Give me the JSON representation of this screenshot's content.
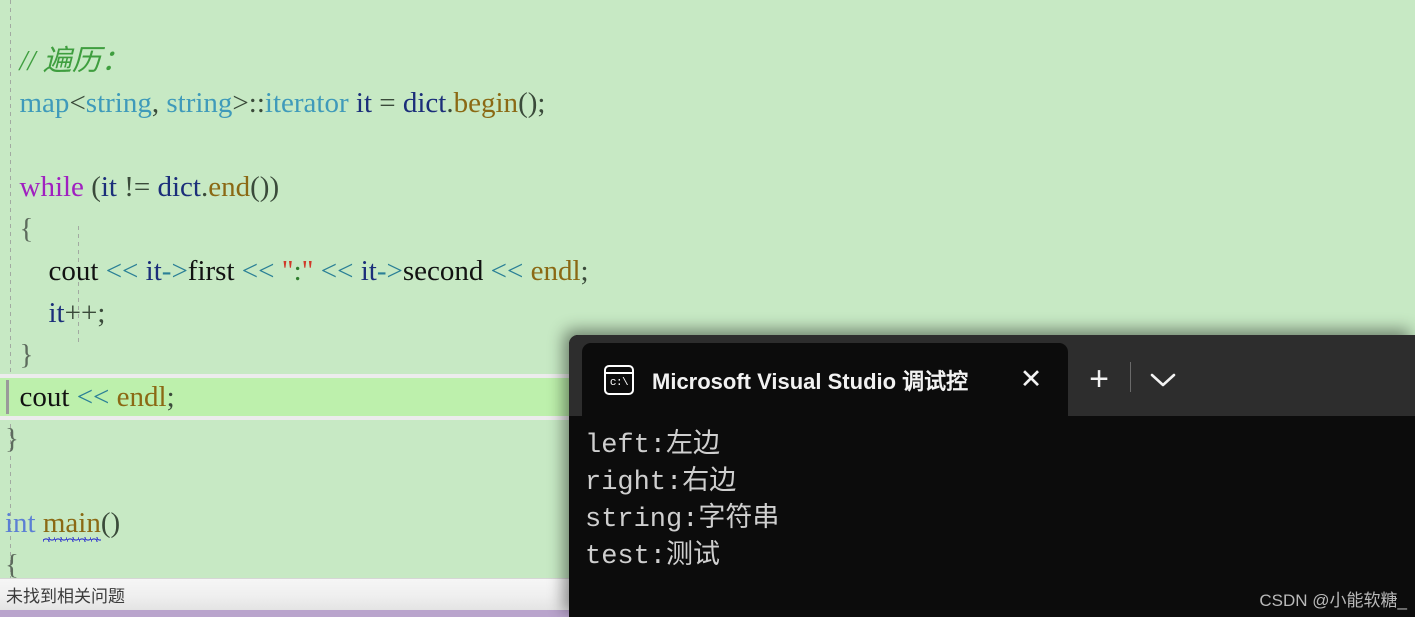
{
  "editor": {
    "background_color": "#c7e9c4",
    "current_line_color": "#bdf0ac",
    "lines": [
      {
        "indent": "  ",
        "tokens": [
          {
            "cls": "t-cmt",
            "text": "// 遍历："
          }
        ]
      },
      {
        "indent": "  ",
        "tokens": [
          {
            "cls": "t-type",
            "text": "map"
          },
          {
            "cls": "t-punct",
            "text": "<"
          },
          {
            "cls": "t-type",
            "text": "string"
          },
          {
            "cls": "t-punct",
            "text": ", "
          },
          {
            "cls": "t-type",
            "text": "string"
          },
          {
            "cls": "t-punct",
            "text": ">::"
          },
          {
            "cls": "t-type",
            "text": "iterator"
          },
          {
            "cls": "t-plain",
            "text": " "
          },
          {
            "cls": "t-var",
            "text": "it"
          },
          {
            "cls": "t-plain",
            "text": " "
          },
          {
            "cls": "t-punct",
            "text": "="
          },
          {
            "cls": "t-plain",
            "text": " "
          },
          {
            "cls": "t-var",
            "text": "dict"
          },
          {
            "cls": "t-punct",
            "text": "."
          },
          {
            "cls": "t-fn",
            "text": "begin"
          },
          {
            "cls": "t-punct",
            "text": "();"
          }
        ]
      },
      {
        "indent": "",
        "tokens": []
      },
      {
        "indent": "  ",
        "tokens": [
          {
            "cls": "t-kw",
            "text": "while"
          },
          {
            "cls": "t-plain",
            "text": " "
          },
          {
            "cls": "t-punct",
            "text": "("
          },
          {
            "cls": "t-var",
            "text": "it"
          },
          {
            "cls": "t-plain",
            "text": " "
          },
          {
            "cls": "t-punct",
            "text": "!="
          },
          {
            "cls": "t-plain",
            "text": " "
          },
          {
            "cls": "t-var",
            "text": "dict"
          },
          {
            "cls": "t-punct",
            "text": "."
          },
          {
            "cls": "t-fn",
            "text": "end"
          },
          {
            "cls": "t-punct",
            "text": "())"
          }
        ]
      },
      {
        "indent": "  ",
        "tokens": [
          {
            "cls": "t-brace",
            "text": "{"
          }
        ]
      },
      {
        "indent": "      ",
        "tokens": [
          {
            "cls": "t-plain",
            "text": "cout"
          },
          {
            "cls": "t-plain",
            "text": " "
          },
          {
            "cls": "t-op",
            "text": "<<"
          },
          {
            "cls": "t-plain",
            "text": " "
          },
          {
            "cls": "t-var",
            "text": "it"
          },
          {
            "cls": "t-op",
            "text": "->"
          },
          {
            "cls": "t-plain",
            "text": "first"
          },
          {
            "cls": "t-plain",
            "text": " "
          },
          {
            "cls": "t-op",
            "text": "<<"
          },
          {
            "cls": "t-plain",
            "text": " "
          },
          {
            "cls": "t-quote",
            "text": "\""
          },
          {
            "cls": "t-str",
            "text": ":"
          },
          {
            "cls": "t-quote",
            "text": "\""
          },
          {
            "cls": "t-plain",
            "text": " "
          },
          {
            "cls": "t-op",
            "text": "<<"
          },
          {
            "cls": "t-plain",
            "text": " "
          },
          {
            "cls": "t-var",
            "text": "it"
          },
          {
            "cls": "t-op",
            "text": "->"
          },
          {
            "cls": "t-plain",
            "text": "second"
          },
          {
            "cls": "t-plain",
            "text": " "
          },
          {
            "cls": "t-op",
            "text": "<<"
          },
          {
            "cls": "t-plain",
            "text": " "
          },
          {
            "cls": "t-fn",
            "text": "endl"
          },
          {
            "cls": "t-punct",
            "text": ";"
          }
        ]
      },
      {
        "indent": "      ",
        "tokens": [
          {
            "cls": "t-var",
            "text": "it"
          },
          {
            "cls": "t-punct",
            "text": "++;"
          }
        ]
      },
      {
        "indent": "  ",
        "tokens": [
          {
            "cls": "t-brace",
            "text": "}"
          }
        ]
      },
      {
        "indent": "  ",
        "current": true,
        "tokens": [
          {
            "cls": "t-plain",
            "text": "cout"
          },
          {
            "cls": "t-plain",
            "text": " "
          },
          {
            "cls": "t-op",
            "text": "<<"
          },
          {
            "cls": "t-plain",
            "text": " "
          },
          {
            "cls": "t-fn",
            "text": "endl"
          },
          {
            "cls": "t-punct",
            "text": ";"
          }
        ]
      },
      {
        "indent": "",
        "tokens": [
          {
            "cls": "t-brace",
            "text": "}"
          }
        ]
      },
      {
        "indent": "",
        "tokens": []
      },
      {
        "indent": "",
        "tokens": [
          {
            "cls": "t-int",
            "text": "int"
          },
          {
            "cls": "t-plain",
            "text": " "
          },
          {
            "cls": "t-fn",
            "text": "main",
            "squiggle": true
          },
          {
            "cls": "t-punct",
            "text": "()"
          }
        ]
      },
      {
        "indent": "",
        "tokens": [
          {
            "cls": "t-brace",
            "text": "{"
          }
        ]
      }
    ]
  },
  "status_bar": {
    "text": "未找到相关问题"
  },
  "terminal": {
    "tab": {
      "icon": "console-icon",
      "title": "Microsoft Visual Studio 调试控",
      "close_label": "✕"
    },
    "new_tab_label": "+",
    "dropdown_icon": "chevron-down-icon",
    "output_lines": [
      "left:左边",
      "right:右边",
      "string:字符串",
      "test:测试"
    ],
    "title_bar_color": "#2d2d2d",
    "body_color": "#0c0c0c"
  },
  "watermark": {
    "text": "CSDN @小能软糖_"
  }
}
